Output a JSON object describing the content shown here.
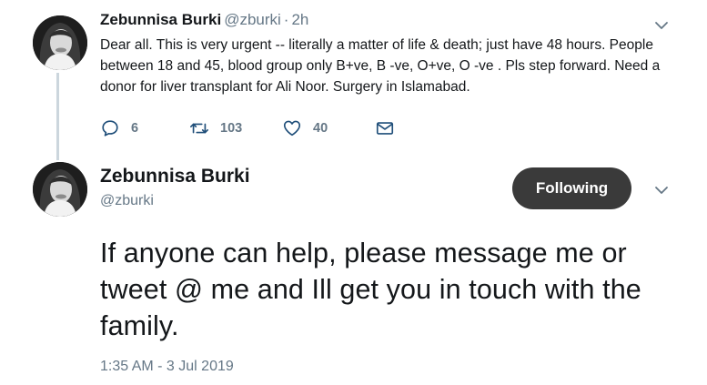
{
  "tweet1": {
    "author_name": "Zebunnisa Burki",
    "author_handle": "@zburki",
    "separator": "·",
    "time": "2h",
    "text": "Dear all. This is very urgent -- literally a matter of life & death; just have 48 hours. People between 18 and 45, blood group only B+ve, B -ve, O+ve, O -ve . Pls step forward. Need a donor for liver transplant for Ali Noor. Surgery in Islamabad.",
    "reply_count": "6",
    "retweet_count": "103",
    "like_count": "40"
  },
  "tweet2": {
    "author_name": "Zebunnisa Burki",
    "author_handle": "@zburki",
    "follow_label": "Following",
    "text": "If anyone can help, please message me or tweet @ me and Ill get you in touch with the family.",
    "timestamp": "1:35 AM - 3 Jul 2019"
  },
  "colors": {
    "text_primary": "#14171a",
    "text_secondary": "#657786",
    "icon": "#1f4e79",
    "following_button": "#3a3a3a",
    "thread_line": "#ccd6dd"
  },
  "icons": {
    "reply": "speech-bubble",
    "retweet": "arrows-loop",
    "like": "heart-outline",
    "message": "envelope",
    "caret": "chevron-down"
  }
}
